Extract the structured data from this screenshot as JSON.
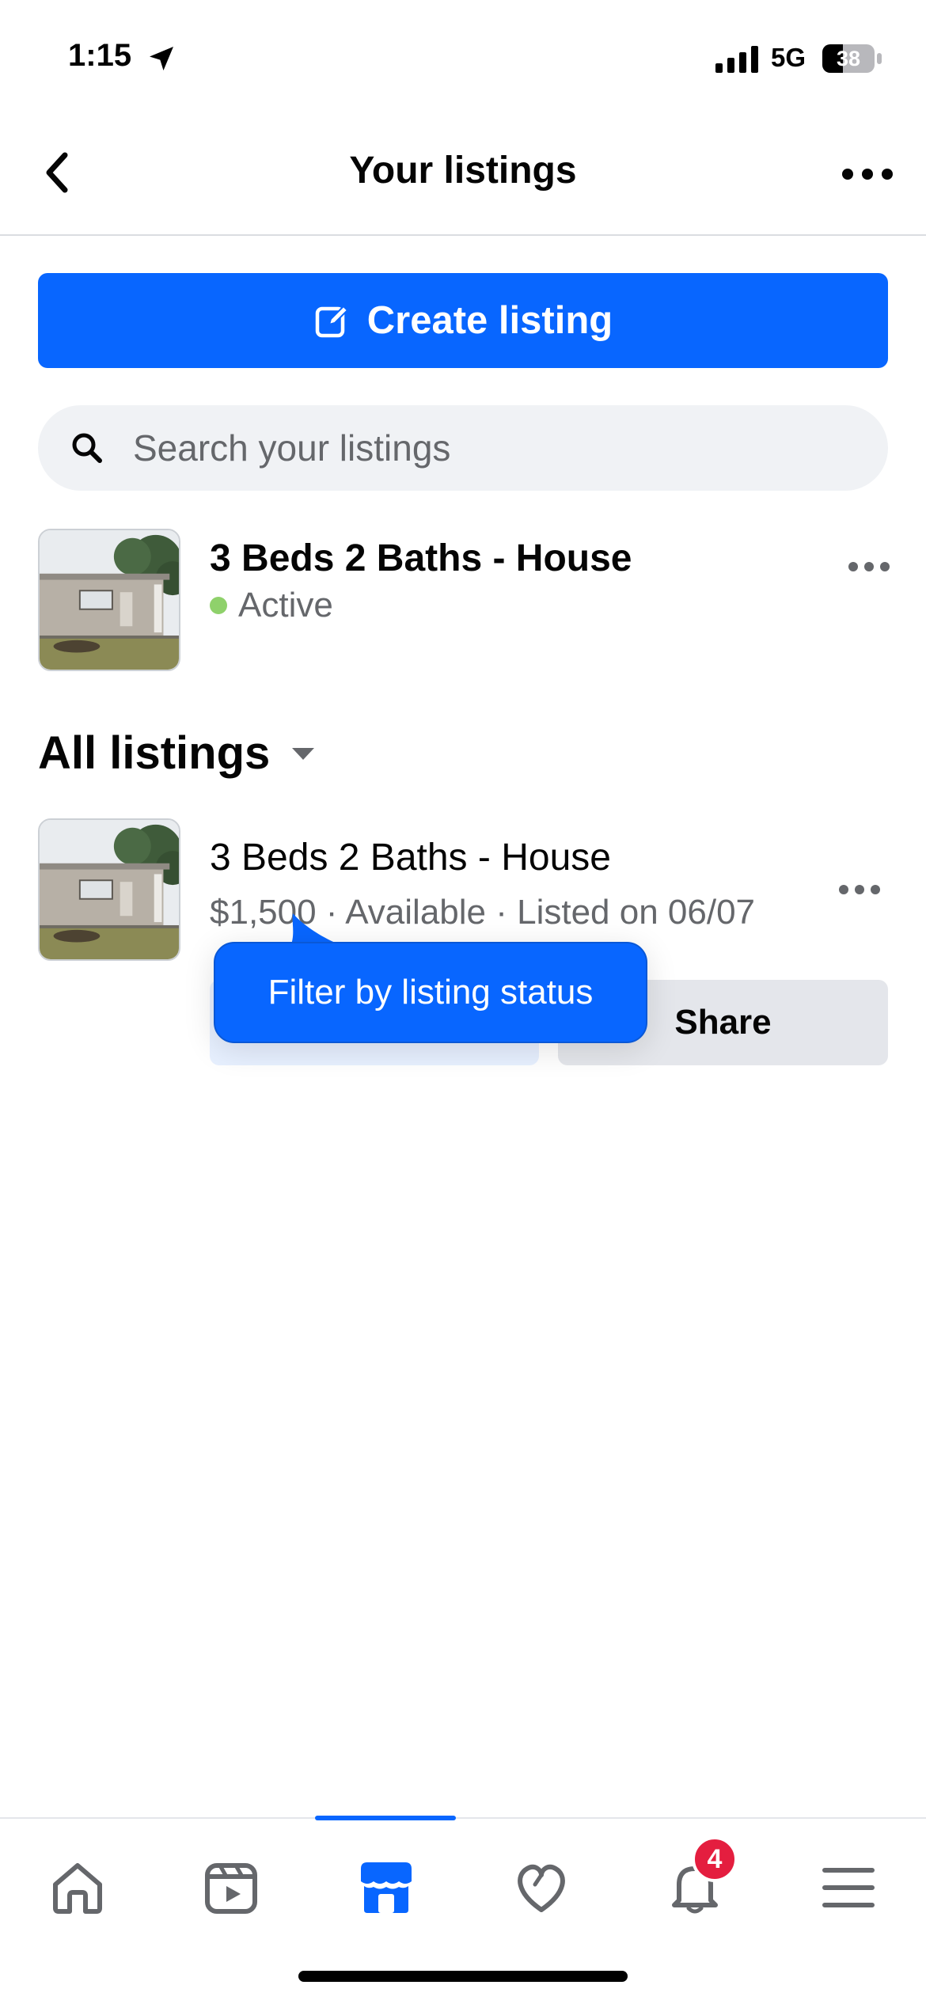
{
  "status_bar": {
    "time": "1:15",
    "network": "5G",
    "battery": "38"
  },
  "header": {
    "title": "Your listings",
    "back_icon": "chevron-left-icon",
    "more_icon": "more-horizontal-icon"
  },
  "create_button": {
    "label": "Create listing",
    "icon": "edit-icon"
  },
  "search": {
    "placeholder": "Search your listings",
    "value": ""
  },
  "active_listing": {
    "title": "3 Beds 2 Baths - House",
    "status": "Active"
  },
  "all_listings": {
    "section_title": "All listings",
    "items": [
      {
        "title": "3 Beds 2 Baths - House",
        "meta": "$1,500 · Available · Listed on 06/07",
        "share_label": "Share"
      }
    ]
  },
  "tooltip": {
    "text": "Filter by listing status"
  },
  "tab_bar": {
    "items": [
      {
        "icon": "home-icon"
      },
      {
        "icon": "video-icon"
      },
      {
        "icon": "marketplace-icon",
        "selected": true
      },
      {
        "icon": "heart-icon"
      },
      {
        "icon": "bell-icon",
        "badge": "4"
      },
      {
        "icon": "menu-icon"
      }
    ]
  },
  "colors": {
    "accent": "#0866ff",
    "active_dot": "#8fd16b",
    "badge": "#e41e3f",
    "secondary_text": "#65676b"
  }
}
